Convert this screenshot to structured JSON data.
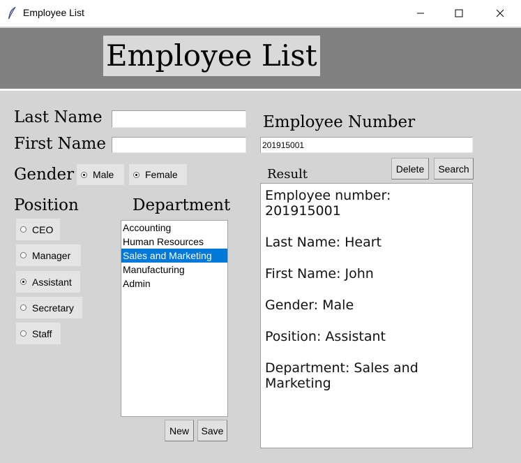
{
  "window": {
    "title": "Employee List",
    "icon": "feather-icon"
  },
  "header": {
    "title": "Employee List"
  },
  "form": {
    "last_name_label": "Last Name",
    "last_name_value": "",
    "first_name_label": "First Name",
    "first_name_value": "",
    "gender_label": "Gender",
    "gender_options": [
      "Male",
      "Female"
    ],
    "gender_selected": "Male",
    "position_label": "Position",
    "positions": [
      "CEO",
      "Manager",
      "Assistant",
      "Secretary",
      "Staff"
    ],
    "position_selected": "Assistant",
    "department_label": "Department",
    "departments": [
      "Accounting",
      "Human Resources",
      "Sales and Marketing",
      "Manufacturing",
      "Admin"
    ],
    "department_selected": "Sales and Marketing",
    "new_label": "New",
    "save_label": "Save"
  },
  "lookup": {
    "employee_number_label": "Employee Number",
    "employee_number_value": "201915001",
    "delete_label": "Delete",
    "search_label": "Search",
    "result_label": "Result"
  },
  "result": {
    "lines": [
      "Employee number: 201915001",
      "Last Name: Heart",
      "First Name: John",
      "Gender: Male",
      "Position: Assistant",
      "Department: Sales and Marketing"
    ]
  },
  "colors": {
    "header_band": "#808080",
    "panel": "#d4d4d4",
    "selection": "#0078d7"
  }
}
